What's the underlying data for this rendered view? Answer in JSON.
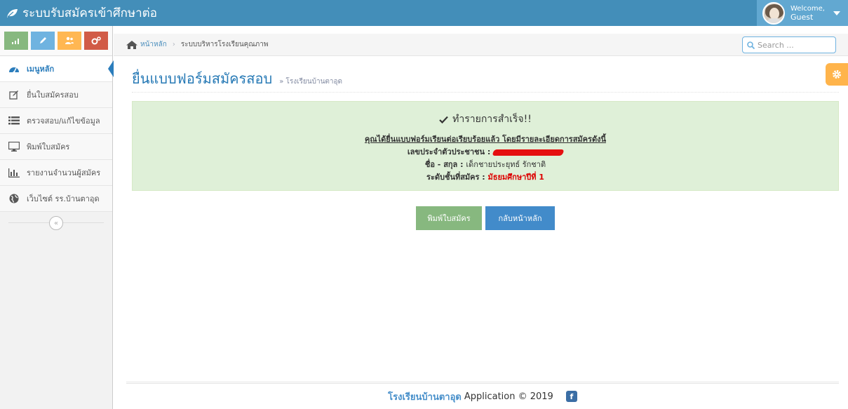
{
  "navbar": {
    "brand": "ระบบรับสมัครเข้าศึกษาต่อ",
    "welcome_line1": "Welcome,",
    "welcome_line2": "Guest"
  },
  "sidebar": {
    "items": [
      {
        "label": "เมนูหลัก",
        "icon": "tachometer-icon",
        "active": true
      },
      {
        "label": "ยื่นใบสมัครสอบ",
        "icon": "edit-icon"
      },
      {
        "label": "ตรวจสอบ/แก้ไขข้อมูล",
        "icon": "list-icon"
      },
      {
        "label": "พิมพ์ใบสมัคร",
        "icon": "desktop-icon"
      },
      {
        "label": "รายงานจำนวนผู้สมัคร",
        "icon": "bar-chart-icon"
      },
      {
        "label": "เว็บไซต์ รร.บ้านตาอุด",
        "icon": "globe-icon"
      }
    ],
    "collapse_glyph": "«"
  },
  "breadcrumb": {
    "home": "หน้าหลัก",
    "current": "ระบบบริหารโรงเรียนคุณภาพ"
  },
  "search": {
    "placeholder": "Search ..."
  },
  "page": {
    "title": "ยื่นแบบฟอร์มสมัครสอบ",
    "subtitle": "» โรงเรียนบ้านตาอุด"
  },
  "alert": {
    "title": "ทำรายการสำเร็จ!!",
    "line1": "คุณได้ยื่นแบบฟอร์มเรียนต่อเรียบร้อยแล้ว โดยมีรายละเอียดการสมัครดังนี้",
    "id_label": "เลขประจำตัวประชาชน :",
    "name_label": "ชื่อ - สกุล :",
    "name_value": "เด็กชายประยุทธ์ รักชาติ",
    "level_label": "ระดับชั้นที่สมัคร :",
    "level_value": "มัธยมศึกษาปีที่ 1"
  },
  "buttons": {
    "print": "พิมพ์ใบสมัคร",
    "home": "กลับหน้าหลัก"
  },
  "footer": {
    "school": "โรงเรียนบ้านตาอุด",
    "text": "Application © 2019",
    "fb": "f"
  },
  "colors": {
    "navbar": "#438eb9",
    "success_bg": "#dff0d8",
    "accent_blue": "#2679b5"
  }
}
